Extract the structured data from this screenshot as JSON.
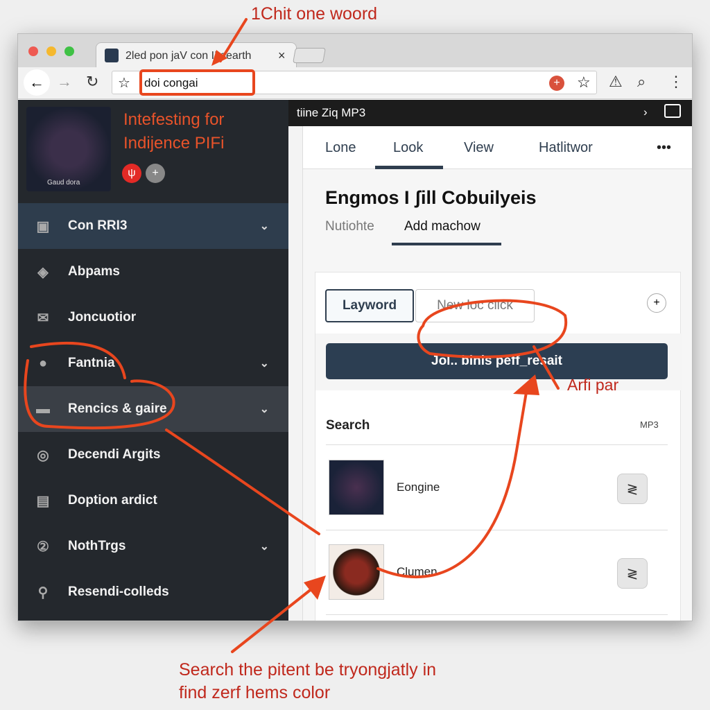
{
  "browser": {
    "tab_title": "2led pon jaV con II searth",
    "tab_close": "×",
    "address": "doi congai"
  },
  "sidebar": {
    "header_title_line1": "Intefesting for",
    "header_title_line2": "Indijence PIFi",
    "album_caption": "Gaud dora",
    "items": [
      {
        "label": "Con RRI3",
        "icon": "camera-icon",
        "chevron": true
      },
      {
        "label": "Abpams",
        "icon": "disc-icon",
        "chevron": false
      },
      {
        "label": "Joncuotior",
        "icon": "mail-icon",
        "chevron": false
      },
      {
        "label": "Fantnia",
        "icon": "user-icon",
        "chevron": true
      },
      {
        "label": "Rencics & gaire",
        "icon": "folder-icon",
        "chevron": true
      },
      {
        "label": "Decendi Argits",
        "icon": "refresh-icon",
        "chevron": false
      },
      {
        "label": "Doption ardict",
        "icon": "calendar-icon",
        "chevron": false
      },
      {
        "label": "NothTrgs",
        "icon": "number-icon",
        "chevron": true
      },
      {
        "label": "Resendi-colleds",
        "icon": "pin-icon",
        "chevron": false
      }
    ]
  },
  "main": {
    "bar_title": "tiine Ziq MP3",
    "tabs": [
      "Lone",
      "Look",
      "View",
      "Hatlitwor"
    ],
    "active_tab": "Look",
    "more": "•••",
    "title": "Engmos I ʃill Cobuilyeis",
    "subtabs": [
      "Nutiohte",
      "Add machow"
    ],
    "active_subtab": "Add machow",
    "buttons": {
      "keyword": "Layword",
      "new": "New loc click",
      "plus": "+"
    },
    "primary_button": "Jol.. binls peff_resait",
    "search_label": "Search",
    "sort": "MP3",
    "results": [
      {
        "name": "Eongine"
      },
      {
        "name": "Clumen"
      },
      {
        "name": ""
      }
    ]
  },
  "annotations": {
    "top": "1Chit one woord",
    "right": "Arfi par",
    "bottom_line1": "Search the pitent be tryongjatly in",
    "bottom_line2": "find zerf hems color",
    "color": "#e8461e"
  }
}
